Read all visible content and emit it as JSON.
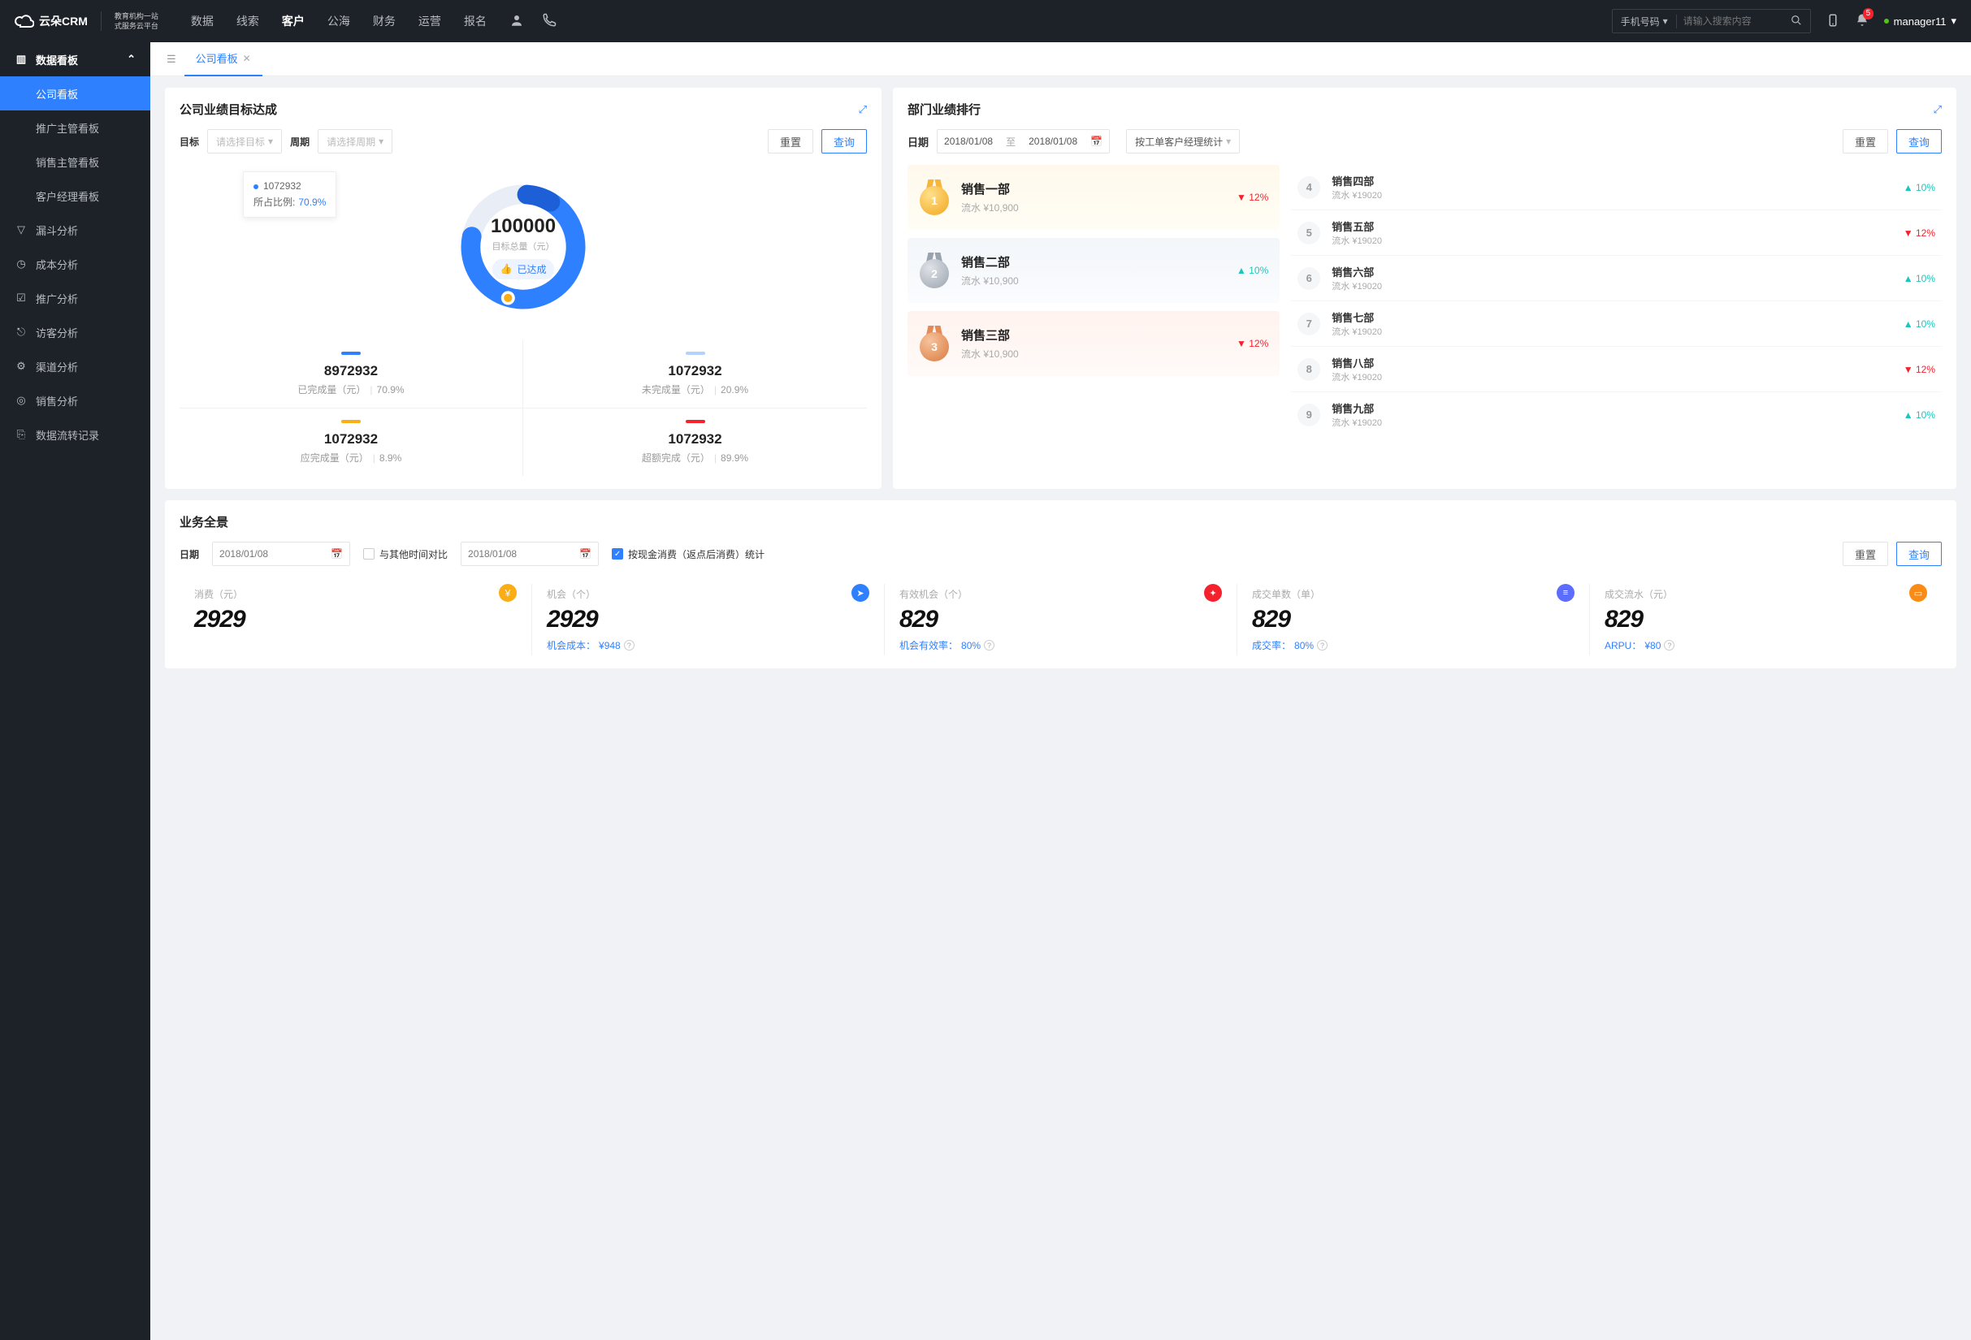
{
  "header": {
    "brand": "云朵CRM",
    "tagline1": "教育机构一站",
    "tagline2": "式服务云平台",
    "nav": [
      "数据",
      "线索",
      "客户",
      "公海",
      "财务",
      "运营",
      "报名"
    ],
    "nav_active_index": 2,
    "search_type": "手机号码",
    "search_placeholder": "请输入搜索内容",
    "badge": "5",
    "username": "manager11"
  },
  "sidebar": {
    "group_label": "数据看板",
    "subs": [
      "公司看板",
      "推广主管看板",
      "销售主管看板",
      "客户经理看板"
    ],
    "sub_active": 0,
    "items": [
      "漏斗分析",
      "成本分析",
      "推广分析",
      "访客分析",
      "渠道分析",
      "销售分析",
      "数据流转记录"
    ]
  },
  "tab": {
    "label": "公司看板"
  },
  "goal": {
    "title": "公司业绩目标达成",
    "label_target": "目标",
    "ph_target": "请选择目标",
    "label_period": "周期",
    "ph_period": "请选择周期",
    "btn_reset": "重置",
    "btn_query": "查询",
    "tooltip_value": "1072932",
    "tooltip_ratio_label": "所占比例:",
    "tooltip_ratio": "70.9%",
    "center_value": "100000",
    "center_label": "目标总量（元）",
    "ach_label": "已达成",
    "kpis": [
      {
        "bar": "#2f80ff",
        "value": "8972932",
        "label": "已完成量（元）",
        "pct": "70.9%"
      },
      {
        "bar": "#b4d2ff",
        "value": "1072932",
        "label": "未完成量（元）",
        "pct": "20.9%"
      },
      {
        "bar": "#faad14",
        "value": "1072932",
        "label": "应完成量（元）",
        "pct": "8.9%"
      },
      {
        "bar": "#f5222d",
        "value": "1072932",
        "label": "超额完成（元）",
        "pct": "89.9%"
      }
    ]
  },
  "rank": {
    "title": "部门业绩排行",
    "label_date": "日期",
    "date_from": "2018/01/08",
    "date_to_label": "至",
    "date_to": "2018/01/08",
    "stat_by": "按工单客户经理统计",
    "btn_reset": "重置",
    "btn_query": "查询",
    "podium": [
      {
        "name": "销售一部",
        "revenue": "流水 ¥10,900",
        "change": "12%",
        "dir": "down"
      },
      {
        "name": "销售二部",
        "revenue": "流水 ¥10,900",
        "change": "10%",
        "dir": "up"
      },
      {
        "name": "销售三部",
        "revenue": "流水 ¥10,900",
        "change": "12%",
        "dir": "down"
      }
    ],
    "list": [
      {
        "num": "4",
        "name": "销售四部",
        "rev": "流水 ¥19020",
        "change": "10%",
        "dir": "up"
      },
      {
        "num": "5",
        "name": "销售五部",
        "rev": "流水 ¥19020",
        "change": "12%",
        "dir": "down"
      },
      {
        "num": "6",
        "name": "销售六部",
        "rev": "流水 ¥19020",
        "change": "10%",
        "dir": "up"
      },
      {
        "num": "7",
        "name": "销售七部",
        "rev": "流水 ¥19020",
        "change": "10%",
        "dir": "up"
      },
      {
        "num": "8",
        "name": "销售八部",
        "rev": "流水 ¥19020",
        "change": "12%",
        "dir": "down"
      },
      {
        "num": "9",
        "name": "销售九部",
        "rev": "流水 ¥19020",
        "change": "10%",
        "dir": "up"
      }
    ]
  },
  "biz": {
    "title": "业务全景",
    "label_date": "日期",
    "date": "2018/01/08",
    "compare_label": "与其他时间对比",
    "date2": "2018/01/08",
    "cash_label": "按现金消费（返点后消费）统计",
    "btn_reset": "重置",
    "btn_query": "查询",
    "metrics": [
      {
        "ttl": "消费（元）",
        "val": "2929",
        "sub": "",
        "sub_val": "",
        "ic": "orange",
        "glyph": "￥"
      },
      {
        "ttl": "机会（个）",
        "val": "2929",
        "sub": "机会成本：",
        "sub_val": "¥948",
        "ic": "blue",
        "glyph": "➤"
      },
      {
        "ttl": "有效机会（个）",
        "val": "829",
        "sub": "机会有效率：",
        "sub_val": "80%",
        "ic": "red",
        "glyph": "✦"
      },
      {
        "ttl": "成交单数（单）",
        "val": "829",
        "sub": "成交率：",
        "sub_val": "80%",
        "ic": "purple",
        "glyph": "≡"
      },
      {
        "ttl": "成交流水（元）",
        "val": "829",
        "sub": "ARPU：",
        "sub_val": "¥80",
        "ic": "orange2",
        "glyph": "▭"
      }
    ]
  },
  "chart_data": {
    "type": "pie",
    "title": "公司业绩目标达成",
    "center_total": 100000,
    "center_label": "目标总量（元）",
    "series": [
      {
        "name": "已完成量",
        "value": 8972932,
        "pct": 70.9,
        "color": "#2f80ff"
      },
      {
        "name": "未完成量",
        "value": 1072932,
        "pct": 20.9,
        "color": "#b4d2ff"
      },
      {
        "name": "应完成量",
        "value": 1072932,
        "pct": 8.9,
        "color": "#faad14"
      },
      {
        "name": "超额完成",
        "value": 1072932,
        "pct": 89.9,
        "color": "#f5222d"
      }
    ]
  }
}
